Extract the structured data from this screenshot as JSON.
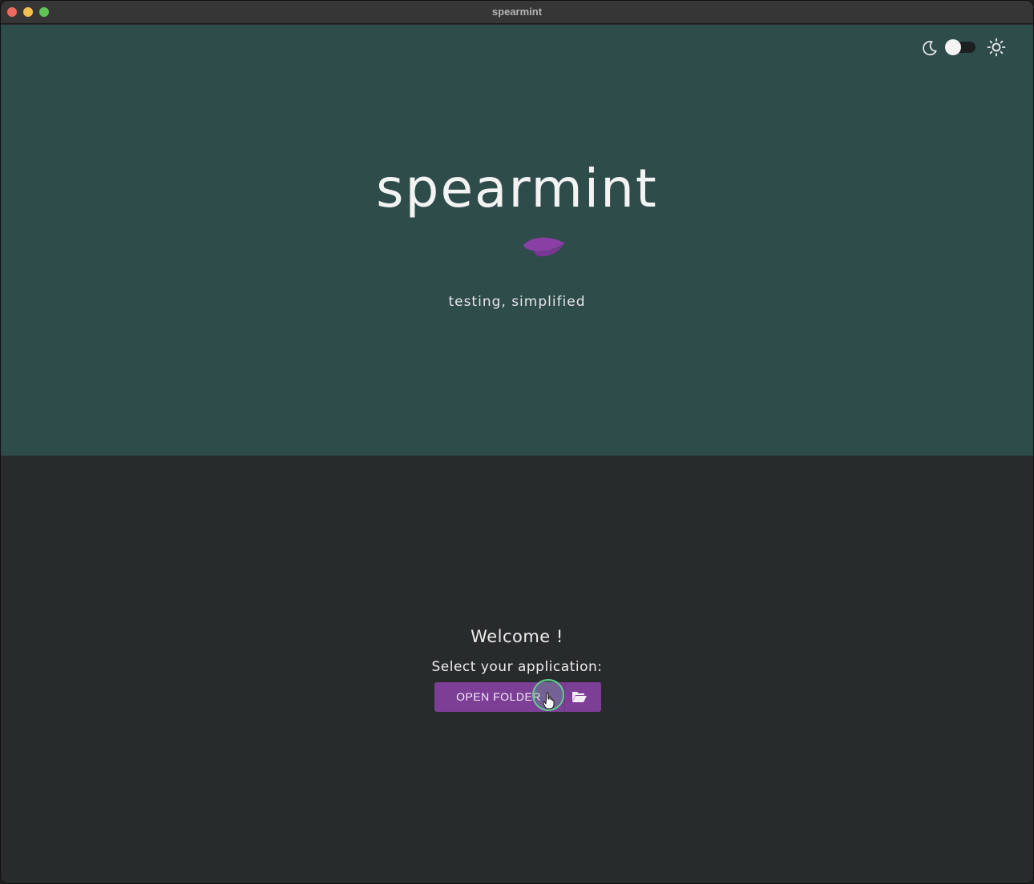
{
  "window": {
    "title": "spearmint"
  },
  "header": {
    "theme_toggle": {
      "left_icon": "moon-icon",
      "right_icon": "sun-icon",
      "state": "dark"
    }
  },
  "hero": {
    "logo_text": "spearmint",
    "logo_icon": "leaf-icon",
    "tagline": "testing, simplified"
  },
  "main": {
    "welcome": "Welcome !",
    "select_label": "Select your application:",
    "open_folder_label": "OPEN FOLDER",
    "open_folder_icon": "folder-open-icon"
  },
  "colors": {
    "hero_bg": "#2e4c4a",
    "body_bg": "#282b2c",
    "accent_purple": "#7d3e96",
    "cursor_highlight": "#5fcf8f"
  }
}
